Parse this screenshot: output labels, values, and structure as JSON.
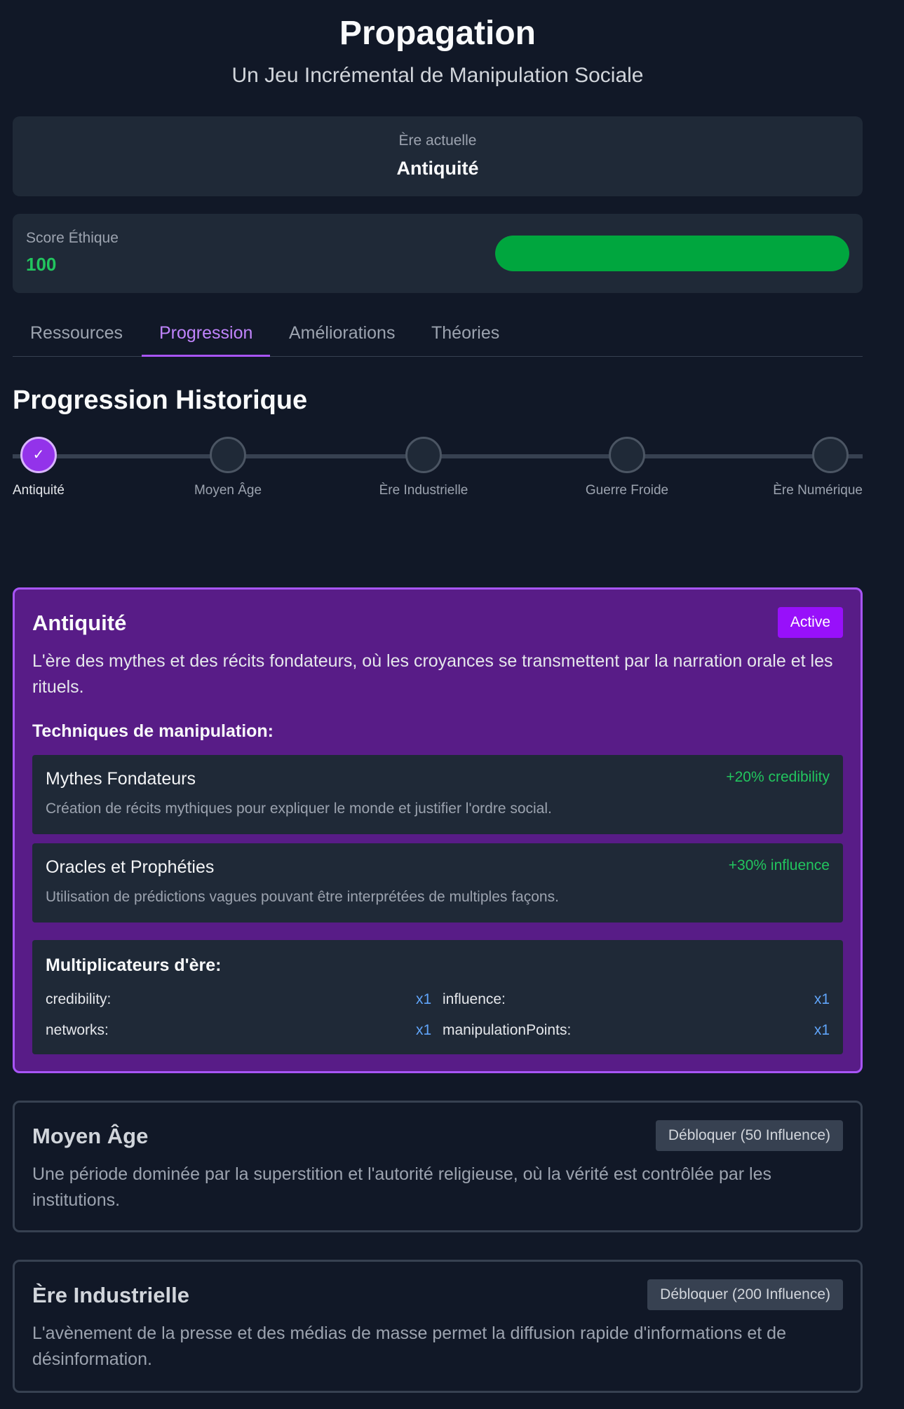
{
  "header": {
    "title": "Propagation",
    "subtitle": "Un Jeu Incrémental de Manipulation Sociale"
  },
  "current_era": {
    "label": "Ère actuelle",
    "value": "Antiquité"
  },
  "ethics": {
    "label": "Score Éthique",
    "value": "100",
    "level_percent": 100,
    "fill_color": "#00a63e"
  },
  "tabs": [
    {
      "label": "Ressources",
      "active": false
    },
    {
      "label": "Progression",
      "active": true
    },
    {
      "label": "Améliorations",
      "active": false
    },
    {
      "label": "Théories",
      "active": false
    }
  ],
  "section_title": "Progression Historique",
  "timeline": [
    {
      "label": "Antiquité",
      "completed": true,
      "mark": "✓"
    },
    {
      "label": "Moyen Âge",
      "completed": false,
      "mark": ""
    },
    {
      "label": "Ère Industrielle",
      "completed": false,
      "mark": ""
    },
    {
      "label": "Guerre Froide",
      "completed": false,
      "mark": ""
    },
    {
      "label": "Ère Numérique",
      "completed": false,
      "mark": ""
    }
  ],
  "eras": {
    "antiquity": {
      "name": "Antiquité",
      "badge": "Active",
      "description": "L'ère des mythes et des récits fondateurs, où les croyances se transmettent par la narration orale et les rituels.",
      "techniques_heading": "Techniques de manipulation:",
      "techniques": [
        {
          "name": "Mythes Fondateurs",
          "bonus": "+20% credibility",
          "description": "Création de récits mythiques pour expliquer le monde et justifier l'ordre social."
        },
        {
          "name": "Oracles et Prophéties",
          "bonus": "+30% influence",
          "description": "Utilisation de prédictions vagues pouvant être interprétées de multiples façons."
        }
      ],
      "multipliers_heading": "Multiplicateurs d'ère:",
      "multipliers": [
        {
          "key": "credibility:",
          "value": "x1"
        },
        {
          "key": "influence:",
          "value": "x1"
        },
        {
          "key": "networks:",
          "value": "x1"
        },
        {
          "key": "manipulationPoints:",
          "value": "x1"
        }
      ]
    },
    "middle_ages": {
      "name": "Moyen Âge",
      "button": "Débloquer (50 Influence)",
      "description": "Une période dominée par la superstition et l'autorité religieuse, où la vérité est contrôlée par les institutions."
    },
    "industrial": {
      "name": "Ère Industrielle",
      "button": "Débloquer (200 Influence)",
      "description": "L'avènement de la presse et des médias de masse permet la diffusion rapide d'informations et de désinformation."
    }
  },
  "colors": {
    "background": "#111827",
    "card": "#1f2937",
    "accent_purple": "#a855f7",
    "active_era_bg": "#581c87",
    "positive_green": "#22c55e",
    "multiplier_blue": "#60a5fa"
  }
}
